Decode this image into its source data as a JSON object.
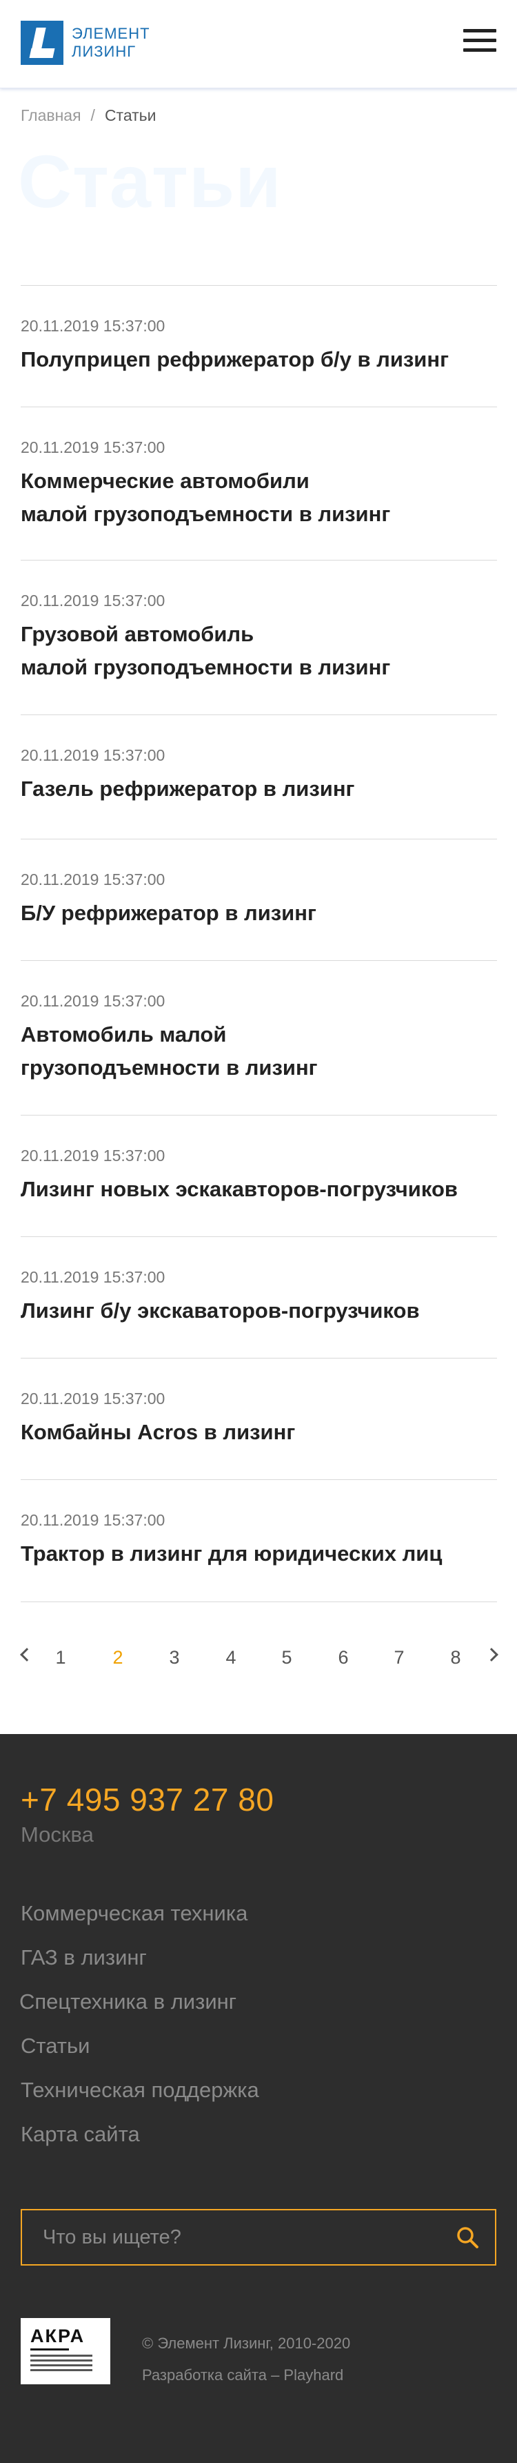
{
  "header": {
    "logo_line1": "ЭЛЕМЕНТ",
    "logo_line2": "ЛИЗИНГ"
  },
  "breadcrumb": {
    "home": "Главная",
    "separator": "/",
    "current": "Статьи"
  },
  "page_title": "Статьи",
  "articles": [
    {
      "date": "20.11.2019 15:37:00",
      "title": "Полуприцеп рефрижератор б/у в лизинг"
    },
    {
      "date": "20.11.2019 15:37:00",
      "title_line1": "Коммерческие автомобили",
      "title_line2": "малой грузоподъемности в лизинг"
    },
    {
      "date": "20.11.2019 15:37:00",
      "title_line1": "Грузовой автомобиль",
      "title_line2": "малой грузоподъемности в лизинг"
    },
    {
      "date": "20.11.2019 15:37:00",
      "title": "Газель рефрижератор в лизинг"
    },
    {
      "date": "20.11.2019 15:37:00",
      "title": "Б/У рефрижератор в лизинг"
    },
    {
      "date": "20.11.2019 15:37:00",
      "title_line1": "Автомобиль малой",
      "title_line2": "грузоподъемности в лизинг"
    },
    {
      "date": "20.11.2019 15:37:00",
      "title": "Лизинг новых эскакавторов-погрузчиков"
    },
    {
      "date": "20.11.2019 15:37:00",
      "title": "Лизинг б/у экскаваторов-погрузчиков"
    },
    {
      "date": "20.11.2019 15:37:00",
      "title": "Комбайны Acros в лизинг"
    },
    {
      "date": "20.11.2019 15:37:00",
      "title": "Трактор в лизинг для юридических лиц"
    }
  ],
  "pagination": {
    "pages": [
      "1",
      "2",
      "3",
      "4",
      "5",
      "6",
      "7",
      "8"
    ],
    "current": "2"
  },
  "footer": {
    "phone": "+7 495 937 27 80",
    "city": "Москва",
    "nav": [
      "Коммерческая техника",
      "ГАЗ в лизинг",
      "Спецтехника в лизинг",
      "Статьи",
      "Техническая поддержка",
      "Карта сайта"
    ],
    "search_placeholder": "Что вы ищете?",
    "akra_label": "АКРА",
    "copyright": "© Элемент Лизинг, 2010-2020",
    "developer": "Разработка сайта – Playhard"
  },
  "colors": {
    "brand_blue": "#1a6fb3",
    "accent_orange": "#f5a623",
    "footer_bg": "#2d2d2d"
  }
}
